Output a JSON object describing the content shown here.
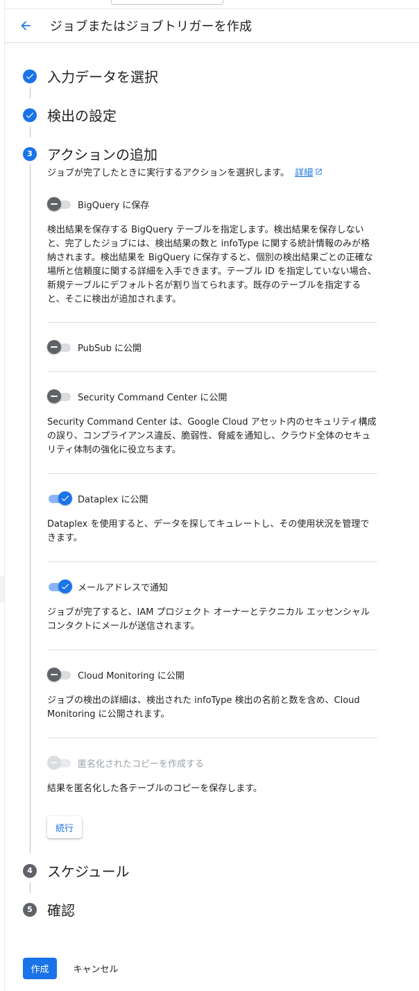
{
  "header": {
    "title": "ジョブまたはジョブトリガーを作成",
    "back_icon": "arrow-back-icon"
  },
  "steps": [
    {
      "label": "入力データを選択",
      "state": "done"
    },
    {
      "label": "検出の設定",
      "state": "done"
    },
    {
      "number": "3",
      "label": "アクションの追加",
      "state": "active"
    },
    {
      "number": "4",
      "label": "スケジュール",
      "state": "todo"
    },
    {
      "number": "5",
      "label": "確認",
      "state": "todo"
    }
  ],
  "actions_step": {
    "description": "ジョブが完了したときに実行するアクションを選択します。",
    "link_label": "詳細",
    "actions": [
      {
        "label": "BigQuery に保存",
        "enabled": false,
        "description": "検出結果を保存する BigQuery テーブルを指定します。検出結果を保存しないと、完了したジョブには、検出結果の数と infoType に関する統計情報のみが格納されます。検出結果を BigQuery に保存すると、個別の検出結果ごとの正確な場所と信頼度に関する詳細を入手できます。テーブル ID を指定していない場合、新規テーブルにデフォルト名が割り当てられます。既存のテーブルを指定すると、そこに検出が追加されます。"
      },
      {
        "label": "PubSub に公開",
        "enabled": false,
        "description": ""
      },
      {
        "label": "Security Command Center に公開",
        "enabled": false,
        "description": "Security Command Center は、Google Cloud アセット内のセキュリティ構成の誤り、コンプライアンス違反、脆弱性、脅威を通知し、クラウド全体のセキュリティ体制の強化に役立ちます。"
      },
      {
        "label": "Dataplex に公開",
        "enabled": true,
        "description": "Dataplex を使用すると、データを探してキュレートし、その使用状況を管理できます。"
      },
      {
        "label": "メールアドレスで通知",
        "enabled": true,
        "description": "ジョブが完了すると、IAM プロジェクト オーナーとテクニカル エッセンシャル コンタクトにメールが送信されます。"
      },
      {
        "label": "Cloud Monitoring に公開",
        "enabled": false,
        "description": "ジョブの検出の詳細は、検出された infoType 検出の名前と数を含め、Cloud Monitoring に公開されます。"
      },
      {
        "label": "匿名化されたコピーを作成する",
        "enabled": false,
        "disabled": true,
        "description": "結果を匿名化した各テーブルのコピーを保存します。"
      }
    ],
    "continue_label": "続行"
  },
  "footer": {
    "create_label": "作成",
    "cancel_label": "キャンセル"
  },
  "colors": {
    "accent": "#1a73e8",
    "step_inactive": "#5f6368",
    "toggle_off": "#5f6368"
  }
}
